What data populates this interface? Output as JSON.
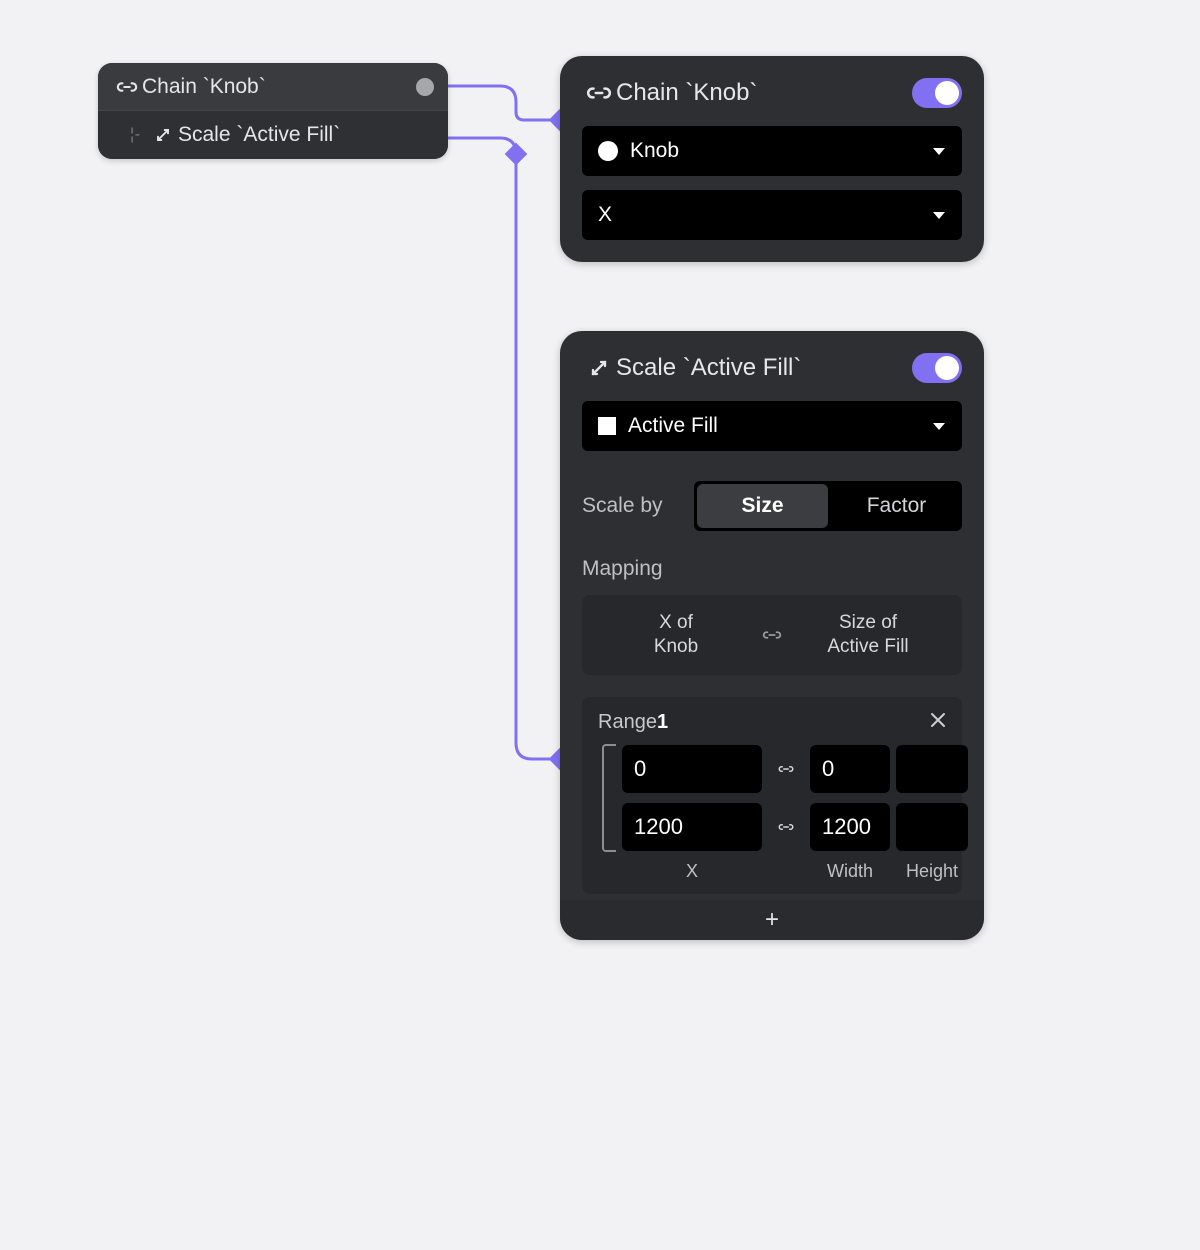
{
  "accent": "#8170f1",
  "tree": {
    "header_label": "Chain `Knob`",
    "child_label": "Scale `Active Fill`"
  },
  "chain_panel": {
    "title": "Chain `Knob`",
    "enabled": true,
    "target_dropdown": {
      "label": "Knob"
    },
    "axis_dropdown": {
      "label": "X"
    }
  },
  "scale_panel": {
    "title": "Scale `Active Fill`",
    "enabled": true,
    "target_dropdown": {
      "label": "Active Fill"
    },
    "scale_by": {
      "label": "Scale by",
      "options": [
        "Size",
        "Factor"
      ],
      "selected": "Size"
    },
    "mapping": {
      "section_label": "Mapping",
      "left_line1": "X of",
      "left_line2": "Knob",
      "right_line1": "Size of",
      "right_line2": "Active Fill"
    },
    "range": {
      "title_prefix": "Range",
      "title_index": "1",
      "rows": [
        {
          "in": "0",
          "out_w": "0",
          "out_h": ""
        },
        {
          "in": "1200",
          "out_w": "1200",
          "out_h": ""
        }
      ],
      "col_labels": {
        "in": "X",
        "out_w": "Width",
        "out_h": "Height"
      }
    },
    "add_label": "+"
  }
}
